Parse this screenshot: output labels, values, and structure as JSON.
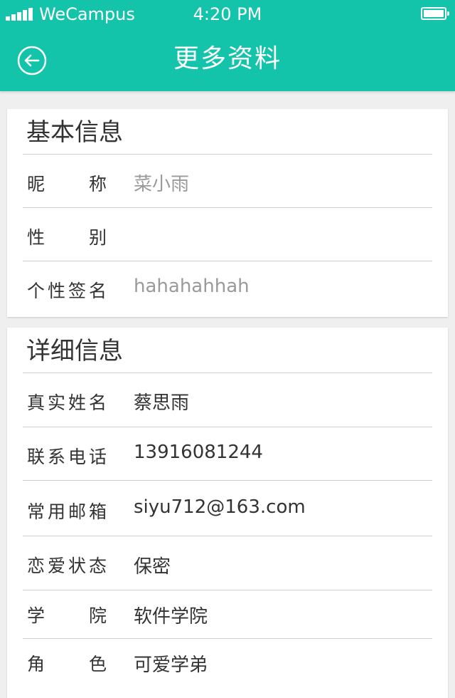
{
  "status_bar": {
    "carrier": "WeCampus",
    "time": "4:20 PM"
  },
  "header": {
    "title": "更多资料",
    "back_icon": "back-arrow-circle-icon"
  },
  "basic_info": {
    "title": "基本信息",
    "rows": [
      {
        "label": "昵 称",
        "value": "菜小雨"
      },
      {
        "label": "性 别",
        "value": ""
      },
      {
        "label": "个性签名",
        "value": "hahahahhah"
      }
    ]
  },
  "detail_info": {
    "title": "详细信息",
    "rows": [
      {
        "label": "真实姓名",
        "value": "蔡思雨"
      },
      {
        "label": "联系电话",
        "value": "13916081244"
      },
      {
        "label": "常用邮箱",
        "value": "siyu712@163.com"
      },
      {
        "label": "恋爱状态",
        "value": "保密"
      },
      {
        "label": "学 院",
        "value": "软件学院"
      },
      {
        "label": "角 色",
        "value": "可爱学弟"
      }
    ]
  },
  "colors": {
    "accent": "#14c4aa",
    "background": "#efefef",
    "text_dark": "#333333",
    "text_muted": "#9a9a9a"
  }
}
